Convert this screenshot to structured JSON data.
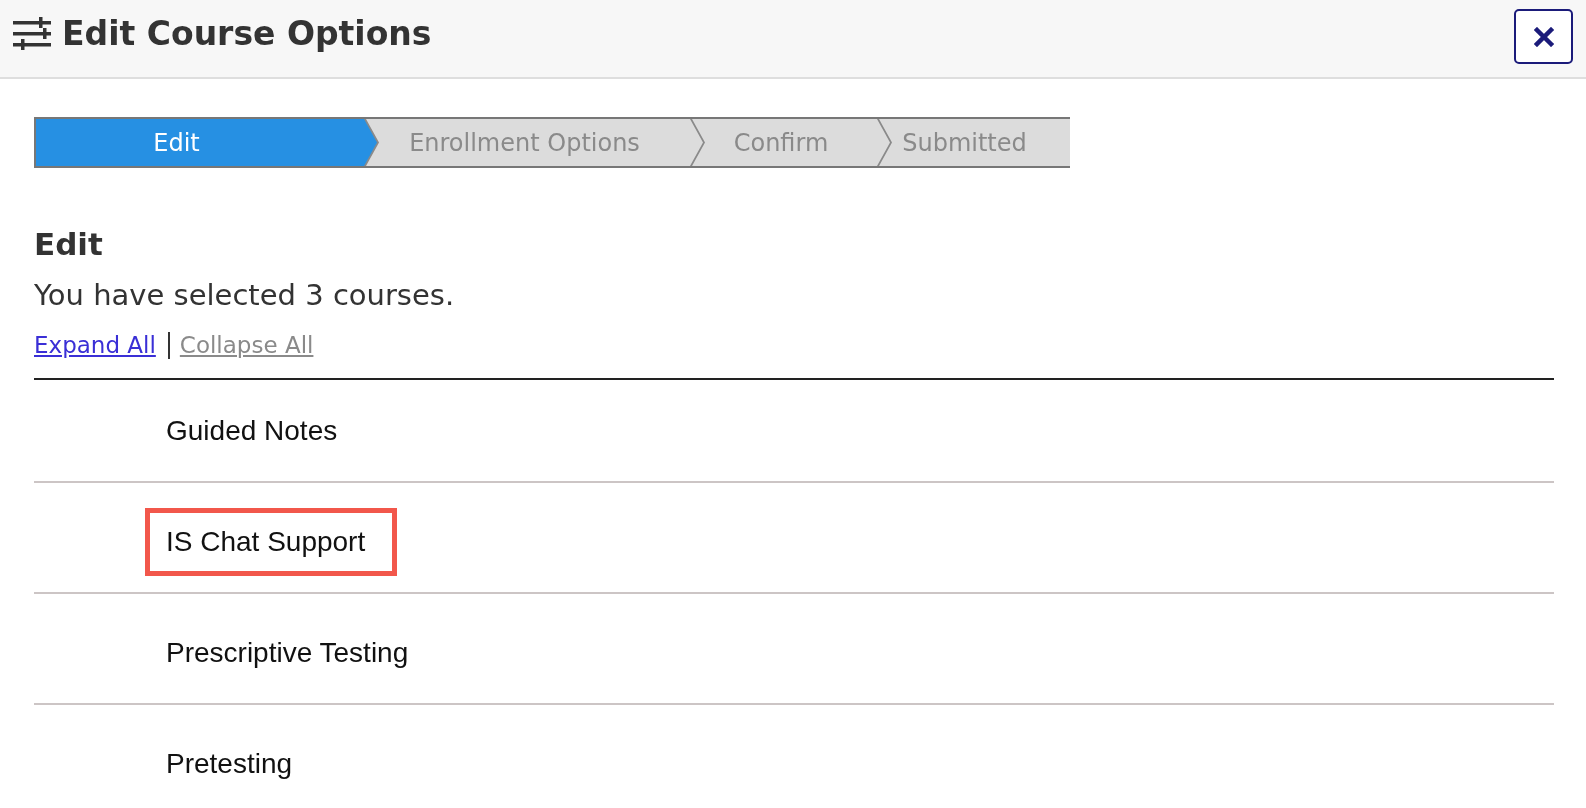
{
  "dialog": {
    "title": "Edit Course Options"
  },
  "steps": [
    {
      "label": "Edit",
      "selected": true
    },
    {
      "label": "Enrollment Options",
      "selected": false
    },
    {
      "label": "Confirm",
      "selected": false
    },
    {
      "label": "Submitted",
      "selected": false
    }
  ],
  "section": {
    "heading": "Edit",
    "summary": "You have selected 3 courses."
  },
  "links": [
    {
      "label": "Expand All",
      "disabled": false
    },
    {
      "label": "Collapse All",
      "disabled": true
    }
  ],
  "courses": [
    {
      "name": "Guided Notes",
      "highlighted": false
    },
    {
      "name": "IS Chat Support",
      "highlighted": true
    },
    {
      "name": "Prescriptive Testing",
      "highlighted": false
    },
    {
      "name": "Pretesting",
      "highlighted": false
    }
  ]
}
